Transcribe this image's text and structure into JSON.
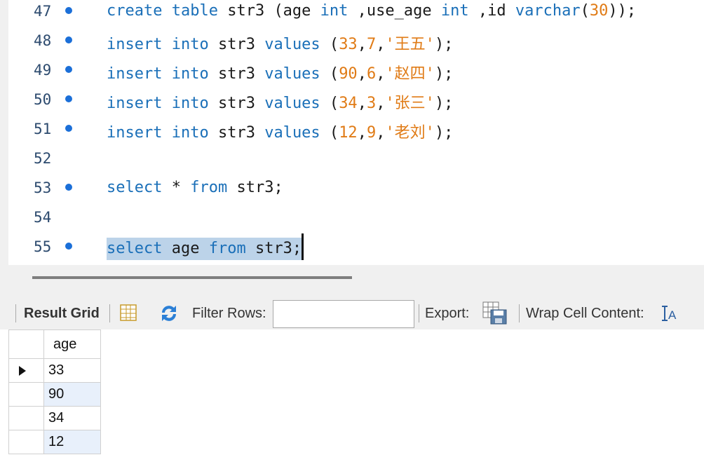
{
  "editor": {
    "lines": [
      {
        "num": "47",
        "marker": true,
        "tokens": [
          [
            "kw",
            "create"
          ],
          [
            "pn",
            " "
          ],
          [
            "kw",
            "table"
          ],
          [
            "pn",
            " str3 (age "
          ],
          [
            "kw",
            "int"
          ],
          [
            "pn",
            " ,use_age "
          ],
          [
            "kw",
            "int"
          ],
          [
            "pn",
            " ,id "
          ],
          [
            "kw",
            "varchar"
          ],
          [
            "pn",
            "("
          ],
          [
            "num",
            "30"
          ],
          [
            "pn",
            "));"
          ]
        ]
      },
      {
        "num": "48",
        "marker": true,
        "tokens": [
          [
            "kw",
            "insert"
          ],
          [
            "pn",
            " "
          ],
          [
            "kw",
            "into"
          ],
          [
            "pn",
            " str3 "
          ],
          [
            "kw",
            "values"
          ],
          [
            "pn",
            " ("
          ],
          [
            "num",
            "33"
          ],
          [
            "pn",
            ","
          ],
          [
            "num",
            "7"
          ],
          [
            "pn",
            ","
          ],
          [
            "str",
            "'王五'"
          ],
          [
            "pn",
            ");"
          ]
        ]
      },
      {
        "num": "49",
        "marker": true,
        "tokens": [
          [
            "kw",
            "insert"
          ],
          [
            "pn",
            " "
          ],
          [
            "kw",
            "into"
          ],
          [
            "pn",
            " str3 "
          ],
          [
            "kw",
            "values"
          ],
          [
            "pn",
            " ("
          ],
          [
            "num",
            "90"
          ],
          [
            "pn",
            ","
          ],
          [
            "num",
            "6"
          ],
          [
            "pn",
            ","
          ],
          [
            "str",
            "'赵四'"
          ],
          [
            "pn",
            ");"
          ]
        ]
      },
      {
        "num": "50",
        "marker": true,
        "tokens": [
          [
            "kw",
            "insert"
          ],
          [
            "pn",
            " "
          ],
          [
            "kw",
            "into"
          ],
          [
            "pn",
            " str3 "
          ],
          [
            "kw",
            "values"
          ],
          [
            "pn",
            " ("
          ],
          [
            "num",
            "34"
          ],
          [
            "pn",
            ","
          ],
          [
            "num",
            "3"
          ],
          [
            "pn",
            ","
          ],
          [
            "str",
            "'张三'"
          ],
          [
            "pn",
            ");"
          ]
        ]
      },
      {
        "num": "51",
        "marker": true,
        "tokens": [
          [
            "kw",
            "insert"
          ],
          [
            "pn",
            " "
          ],
          [
            "kw",
            "into"
          ],
          [
            "pn",
            " str3 "
          ],
          [
            "kw",
            "values"
          ],
          [
            "pn",
            " ("
          ],
          [
            "num",
            "12"
          ],
          [
            "pn",
            ","
          ],
          [
            "num",
            "9"
          ],
          [
            "pn",
            ","
          ],
          [
            "str",
            "'老刘'"
          ],
          [
            "pn",
            ");"
          ]
        ]
      },
      {
        "num": "52",
        "marker": false,
        "tokens": []
      },
      {
        "num": "53",
        "marker": true,
        "tokens": [
          [
            "kw",
            "select"
          ],
          [
            "pn",
            " * "
          ],
          [
            "kw",
            "from"
          ],
          [
            "pn",
            " str3;"
          ]
        ]
      },
      {
        "num": "54",
        "marker": false,
        "tokens": []
      },
      {
        "num": "55",
        "marker": true,
        "selected": true,
        "tokens": [
          [
            "kw",
            "select"
          ],
          [
            "pn",
            " age "
          ],
          [
            "kw",
            "from"
          ],
          [
            "pn",
            " str3;"
          ]
        ]
      }
    ]
  },
  "toolbar": {
    "result_grid_label": "Result Grid",
    "filter_label": "Filter Rows:",
    "filter_value": "",
    "export_label": "Export:",
    "wrap_label": "Wrap Cell Content:"
  },
  "grid": {
    "column": "age",
    "rows": [
      "33",
      "90",
      "34",
      "12"
    ]
  },
  "icons": {
    "form": "grid-form-icon",
    "refresh": "refresh-icon",
    "export": "export-icon",
    "wrap": "wrap-text-icon",
    "current_row": "current-row-arrow-icon"
  }
}
